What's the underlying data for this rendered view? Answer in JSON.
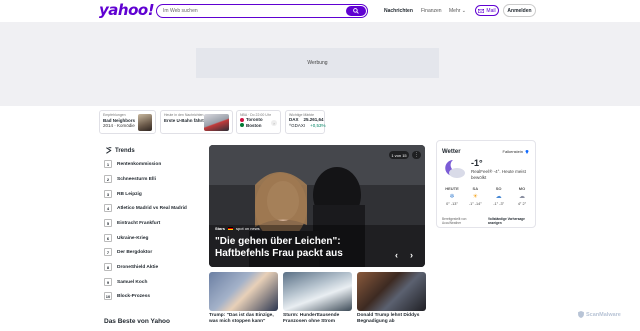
{
  "header": {
    "logo": "yahoo!",
    "search_placeholder": "Im Web suchen",
    "nav": [
      "Nachrichten",
      "Finanzen",
      "Mehr"
    ],
    "mail": "Mail",
    "login": "Anmelden"
  },
  "ad": {
    "label": "Werbung"
  },
  "ticker": {
    "card1": {
      "label": "Empfehlungen",
      "title": "Bad Neighbors",
      "sub": "2014 · Komödie"
    },
    "card2": {
      "label": "Heute in den Nachrichten",
      "title": "Erste U-Bahn fährt"
    },
    "card3": {
      "label": "NBA · Do 22:00 Uhr",
      "team1": "Toronto",
      "team2": "Boston"
    },
    "card4": {
      "label": "Wichtige Märkte",
      "name": "DAX",
      "sym": "^GDAXI",
      "value": "25.261,64",
      "change": "+0,53%"
    }
  },
  "trends": {
    "title": "Trends",
    "items": [
      {
        "n": "1",
        "label": "Rentenkommission"
      },
      {
        "n": "2",
        "label": "Schneesturm Elli"
      },
      {
        "n": "3",
        "label": "RB Leipzig"
      },
      {
        "n": "4",
        "label": "Atletico Madrid vs Real Madrid"
      },
      {
        "n": "5",
        "label": "Eintracht Frankfurt"
      },
      {
        "n": "6",
        "label": "Ukraine-Krieg"
      },
      {
        "n": "7",
        "label": "Der Bergdoktor"
      },
      {
        "n": "8",
        "label": "DroneShield Aktie"
      },
      {
        "n": "9",
        "label": "Samuel Koch"
      },
      {
        "n": "10",
        "label": "Block-Prozess"
      }
    ],
    "best_of": "Das Beste von Yahoo"
  },
  "hero": {
    "counter": "1 von 15",
    "source_brand": "Stars",
    "source_name": "spot on news",
    "title": "\"Die gehen über Leichen\": Haftbefehls Frau packt aus"
  },
  "cards": [
    {
      "title": "Trump: \"Das ist das Einzige, was mich stoppen kann\""
    },
    {
      "title": "Sturm: Hunderttausende Franzosen ohne Strom"
    },
    {
      "title": "Donald Trump lehnt Diddys Begnadigung ab"
    }
  ],
  "weather": {
    "title": "Wetter",
    "location": "Falkenstein",
    "temp": "-1°",
    "desc": "RealFeel® -4°. Heute meist bewölkt",
    "days": [
      {
        "label": "HEUTE",
        "range": "0° -13°",
        "icon": "snow-icon"
      },
      {
        "label": "SA",
        "range": "-1° -14°",
        "icon": "sun-icon"
      },
      {
        "label": "SO",
        "range": "-1° -3°",
        "icon": "cloud-snow-icon"
      },
      {
        "label": "MO",
        "range": "4° 2°",
        "icon": "cloud-icon"
      }
    ],
    "foot_left": "Bereitgestellt von AccuWeather",
    "foot_right": "Vollständige Vorhersage anzeigen"
  },
  "watermark": "ScanMalware",
  "colors": {
    "brand": "#6001d2",
    "up": "#008463"
  }
}
